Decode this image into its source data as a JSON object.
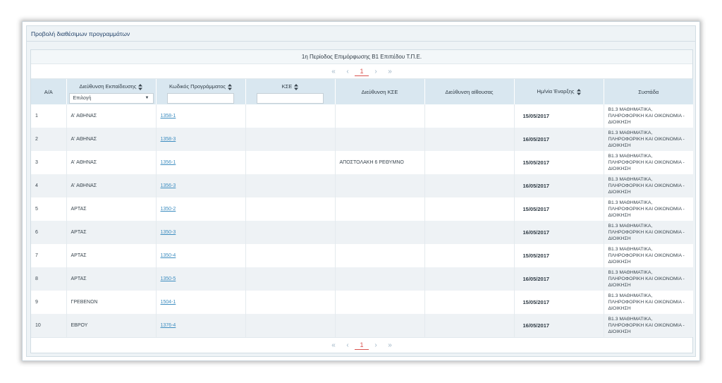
{
  "panel": {
    "title": "Προβολή διαθέσιμων προγραμμάτων"
  },
  "table": {
    "caption": "1η Περίοδος Επιμόρφωσης Β1 Επιπέδου Τ.Π.Ε.",
    "pager": {
      "first": "«",
      "prev": "‹",
      "current": "1",
      "next": "›",
      "last": "»"
    },
    "headers": {
      "aa": "Α/Α",
      "directorate": "Διεύθυνση Εκπαίδευσης",
      "program_code": "Κωδικός Προγράμματος",
      "kse": "ΚΣΕ",
      "kse_address": "Διεύθυνση ΚΣΕ",
      "room_address": "Διεύθυνση αίθουσας",
      "start_date": "Ημ/νία Έναρξης",
      "subject": "Συστάδα"
    },
    "filters": {
      "directorate_selected": "Επιλογή"
    },
    "rows": [
      {
        "aa": "1",
        "directorate": "Α' ΑΘΗΝΑΣ",
        "code": "1358-1",
        "kse": "",
        "kse_address": "",
        "room_address": "",
        "date": "15/05/2017",
        "subject": "Β1.3 ΜΑΘΗΜΑΤΙΚΑ, ΠΛΗΡΟΦΟΡΙΚΗ ΚΑΙ ΟΙΚΟΝΟΜΙΑ - ΔΙΟΙΚΗΣΗ"
      },
      {
        "aa": "2",
        "directorate": "Α' ΑΘΗΝΑΣ",
        "code": "1358-3",
        "kse": "",
        "kse_address": "",
        "room_address": "",
        "date": "16/05/2017",
        "subject": "Β1.3 ΜΑΘΗΜΑΤΙΚΑ, ΠΛΗΡΟΦΟΡΙΚΗ ΚΑΙ ΟΙΚΟΝΟΜΙΑ - ΔΙΟΙΚΗΣΗ"
      },
      {
        "aa": "3",
        "directorate": "Α' ΑΘΗΝΑΣ",
        "code": "1356-1",
        "kse": "",
        "kse_address": "ΑΠΟΣΤΟΛΑΚΗ 6 ΡΕΘΥΜΝΟ",
        "room_address": "",
        "date": "15/05/2017",
        "subject": "Β1.3 ΜΑΘΗΜΑΤΙΚΑ, ΠΛΗΡΟΦΟΡΙΚΗ ΚΑΙ ΟΙΚΟΝΟΜΙΑ - ΔΙΟΙΚΗΣΗ"
      },
      {
        "aa": "4",
        "directorate": "Α' ΑΘΗΝΑΣ",
        "code": "1356-3",
        "kse": "",
        "kse_address": "",
        "room_address": "",
        "date": "16/05/2017",
        "subject": "Β1.3 ΜΑΘΗΜΑΤΙΚΑ, ΠΛΗΡΟΦΟΡΙΚΗ ΚΑΙ ΟΙΚΟΝΟΜΙΑ - ΔΙΟΙΚΗΣΗ"
      },
      {
        "aa": "5",
        "directorate": "ΑΡΤΑΣ",
        "code": "1350-2",
        "kse": "",
        "kse_address": "",
        "room_address": "",
        "date": "15/05/2017",
        "subject": "Β1.3 ΜΑΘΗΜΑΤΙΚΑ, ΠΛΗΡΟΦΟΡΙΚΗ ΚΑΙ ΟΙΚΟΝΟΜΙΑ - ΔΙΟΙΚΗΣΗ"
      },
      {
        "aa": "6",
        "directorate": "ΑΡΤΑΣ",
        "code": "1350-3",
        "kse": "",
        "kse_address": "",
        "room_address": "",
        "date": "16/05/2017",
        "subject": "Β1.3 ΜΑΘΗΜΑΤΙΚΑ, ΠΛΗΡΟΦΟΡΙΚΗ ΚΑΙ ΟΙΚΟΝΟΜΙΑ - ΔΙΟΙΚΗΣΗ"
      },
      {
        "aa": "7",
        "directorate": "ΑΡΤΑΣ",
        "code": "1350-4",
        "kse": "",
        "kse_address": "",
        "room_address": "",
        "date": "15/05/2017",
        "subject": "Β1.3 ΜΑΘΗΜΑΤΙΚΑ, ΠΛΗΡΟΦΟΡΙΚΗ ΚΑΙ ΟΙΚΟΝΟΜΙΑ - ΔΙΟΙΚΗΣΗ"
      },
      {
        "aa": "8",
        "directorate": "ΑΡΤΑΣ",
        "code": "1350-5",
        "kse": "",
        "kse_address": "",
        "room_address": "",
        "date": "16/05/2017",
        "subject": "Β1.3 ΜΑΘΗΜΑΤΙΚΑ, ΠΛΗΡΟΦΟΡΙΚΗ ΚΑΙ ΟΙΚΟΝΟΜΙΑ - ΔΙΟΙΚΗΣΗ"
      },
      {
        "aa": "9",
        "directorate": "ΓΡΕΒΕΝΩΝ",
        "code": "1504-1",
        "kse": "",
        "kse_address": "",
        "room_address": "",
        "date": "15/05/2017",
        "subject": "Β1.3 ΜΑΘΗΜΑΤΙΚΑ, ΠΛΗΡΟΦΟΡΙΚΗ ΚΑΙ ΟΙΚΟΝΟΜΙΑ - ΔΙΟΙΚΗΣΗ"
      },
      {
        "aa": "10",
        "directorate": "ΕΒΡΟΥ",
        "code": "1376-4",
        "kse": "",
        "kse_address": "",
        "room_address": "",
        "date": "16/05/2017",
        "subject": "Β1.3 ΜΑΘΗΜΑΤΙΚΑ, ΠΛΗΡΟΦΟΡΙΚΗ ΚΑΙ ΟΙΚΟΝΟΜΙΑ - ΔΙΟΙΚΗΣΗ"
      }
    ]
  },
  "colors": {
    "header_bg": "#d9e7f0",
    "link": "#3d8dc0",
    "page_current": "#d9534f",
    "pager_arrows": "#9eb5c6"
  }
}
